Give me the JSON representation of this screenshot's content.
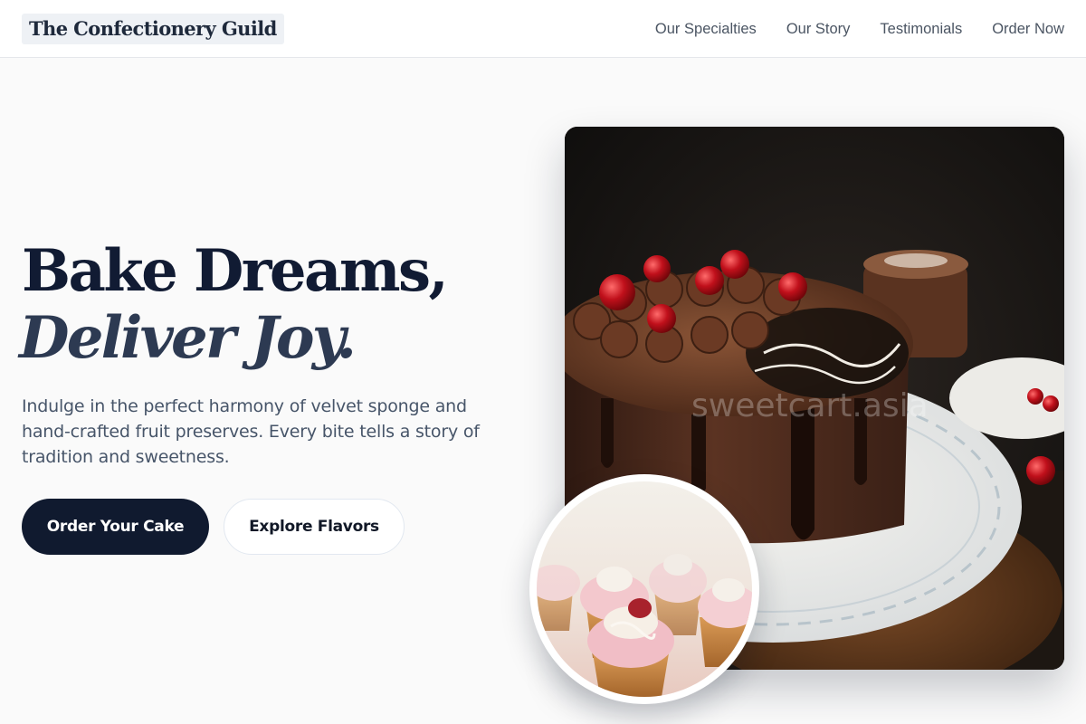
{
  "site": {
    "logo": "The Confectionery Guild"
  },
  "nav": {
    "items": [
      {
        "label": "Our Specialties"
      },
      {
        "label": "Our Story"
      },
      {
        "label": "Testimonials"
      },
      {
        "label": "Order Now"
      }
    ]
  },
  "hero": {
    "headline_line1": "Bake Dreams,",
    "headline_line2": "Deliver Joy.",
    "description": "Indulge in the perfect harmony of velvet sponge and hand-crafted fruit preserves. Every bite tells a story of tradition and sweetness.",
    "primary_cta": "Order Your Cake",
    "secondary_cta": "Explore Flavors",
    "photo_watermark": "sweetcart.asia"
  },
  "colors": {
    "ink": "#0f172a",
    "primary_button": "#101a2f",
    "muted_text": "#475569",
    "page_background": "#fafafa"
  },
  "images": {
    "main_photo": "chocolate-cake-photo",
    "inset_photo": "cupcakes-photo"
  }
}
